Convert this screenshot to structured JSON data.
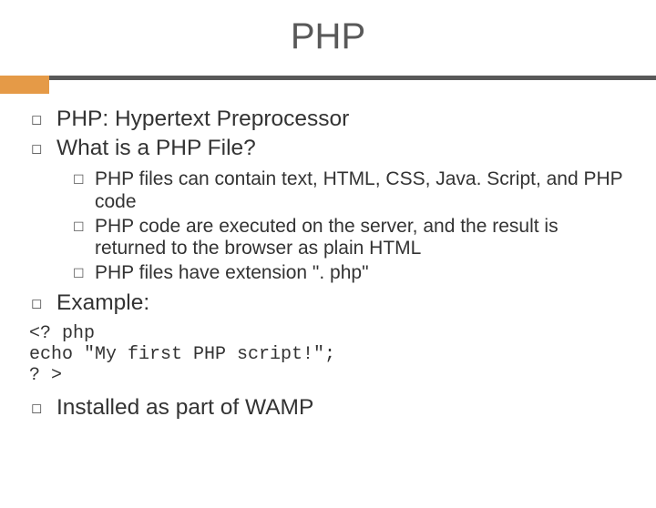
{
  "title": "PHP",
  "bullets": {
    "b1": "PHP: Hypertext Preprocessor",
    "b2": "What is a PHP File?",
    "sub1": "PHP files can contain text, HTML, CSS, Java. Script, and PHP code",
    "sub2": "PHP code are executed on the server, and the result is returned to the browser as plain HTML",
    "sub3": "PHP files have extension \". php\"",
    "b3": "Example:",
    "b4": "Installed as part of WAMP"
  },
  "code": "<? php\necho \"My first PHP script!\";\n? >",
  "glyph": {
    "hollow_square": "◻",
    "checkbox": "☐"
  }
}
